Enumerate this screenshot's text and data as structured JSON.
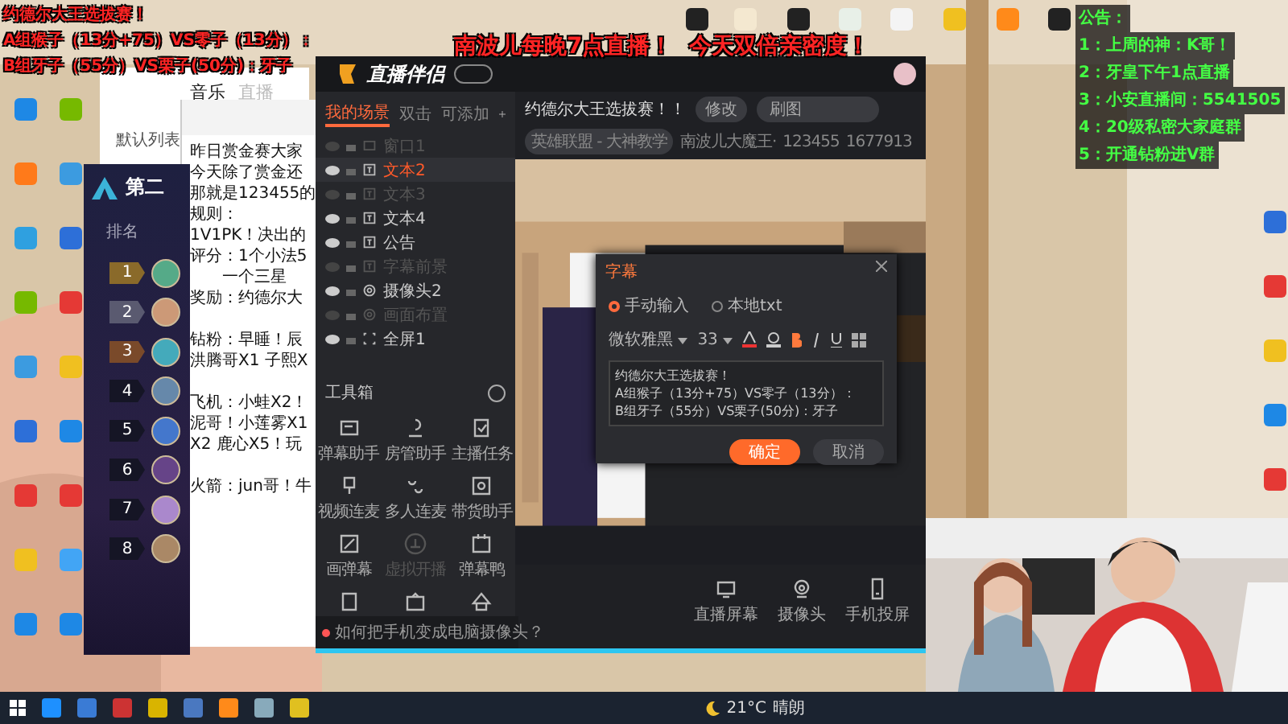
{
  "overlay": {
    "title": "约德尔大王选拔赛！",
    "lines": [
      "A组猴子（13分+75）VS零子（13分）：",
      "B组牙子（55分）VS栗子(50分)：牙子"
    ],
    "banner": [
      "南波儿每晚7点直播！",
      "今天双倍亲密度！"
    ]
  },
  "notice": {
    "title": "公告：",
    "items": [
      "1：上周的神：K哥！",
      "2：牙皇下午1点直播",
      "3：小安直播间：5541505",
      "4：20级私密大家庭群",
      "5：开通钻粉进V群"
    ]
  },
  "browser": {
    "tabs": [
      {
        "label": "音乐",
        "selected": true
      },
      {
        "label": "直播",
        "selected": false
      }
    ],
    "menu_item": "默认列表"
  },
  "notepad": {
    "paragraphs": [
      [
        "昨日赏金赛大家",
        "今天除了赏金还",
        "那就是123455的",
        "规则：",
        "1V1PK！决出的",
        "评分：1个小法5",
        "　　一个三星",
        "奖励：约德尔大"
      ],
      [
        "钻粉：早睡！辰",
        "洪腾哥X1 子熙X"
      ],
      [
        "飞机：小蛙X2！",
        "泥哥！小莲雾X1",
        "X2 鹿心X5！玩"
      ],
      [
        "火箭：jun哥！牛"
      ]
    ]
  },
  "ranking": {
    "title": "第二",
    "column": "排名",
    "ranks": [
      "1",
      "2",
      "3",
      "4",
      "5",
      "6",
      "7",
      "8"
    ]
  },
  "app": {
    "name": "直播伴侣",
    "scene_tabs": [
      {
        "label": "我的场景",
        "selected": true
      },
      {
        "label": "双击",
        "selected": false
      },
      {
        "label": "可添加",
        "selected": false
      }
    ],
    "sources": [
      {
        "label": "窗口1",
        "kind": "window",
        "visible": false,
        "selected": false
      },
      {
        "label": "文本2",
        "kind": "text",
        "visible": true,
        "selected": true
      },
      {
        "label": "文本3",
        "kind": "text",
        "visible": false,
        "selected": false
      },
      {
        "label": "文本4",
        "kind": "text",
        "visible": true,
        "selected": false
      },
      {
        "label": "公告",
        "kind": "text",
        "visible": true,
        "selected": false
      },
      {
        "label": "字幕前景",
        "kind": "text",
        "visible": false,
        "selected": false
      },
      {
        "label": "摄像头2",
        "kind": "camera",
        "visible": true,
        "selected": false
      },
      {
        "label": "画面布置",
        "kind": "camera",
        "visible": false,
        "selected": false
      },
      {
        "label": "全屏1",
        "kind": "screen",
        "visible": true,
        "selected": false
      }
    ],
    "toolbox_title": "工具箱",
    "tools": [
      {
        "label": "弹幕助手",
        "disabled": false
      },
      {
        "label": "房管助手",
        "disabled": false
      },
      {
        "label": "主播任务",
        "disabled": false
      },
      {
        "label": "视频连麦",
        "disabled": false
      },
      {
        "label": "多人连麦",
        "disabled": false
      },
      {
        "label": "带货助手",
        "disabled": false
      },
      {
        "label": "画弹幕",
        "disabled": false
      },
      {
        "label": "虚拟开播",
        "disabled": true
      },
      {
        "label": "弹幕鸭",
        "disabled": false
      }
    ],
    "hint": "如何把手机变成电脑摄像头？",
    "stream_title": "约德尔大王选拔赛！！",
    "edit_label": "修改",
    "cover_label": "刷图",
    "category": "英雄联盟 - 大神教学",
    "streamer": "南波儿大魔王·",
    "room_id": "123455",
    "fans": "1677913",
    "bottom_tools": [
      "直播屏幕",
      "摄像头",
      "手机投屏"
    ]
  },
  "dialog": {
    "title": "字幕",
    "modes": [
      {
        "label": "手动输入",
        "selected": true
      },
      {
        "label": "本地txt",
        "selected": false
      }
    ],
    "font": "微软雅黑",
    "size": "33",
    "text": [
      "约德尔大王选拔赛！",
      "A组猴子（13分+75）VS零子（13分）：",
      "B组牙子（55分）VS栗子(50分)：牙子"
    ],
    "buttons": [
      {
        "label": "确定",
        "kind": "primary"
      },
      {
        "label": "取消",
        "kind": "secondary"
      }
    ]
  },
  "taskbar": {
    "temperature": "21°C",
    "weather": "晴朗"
  }
}
